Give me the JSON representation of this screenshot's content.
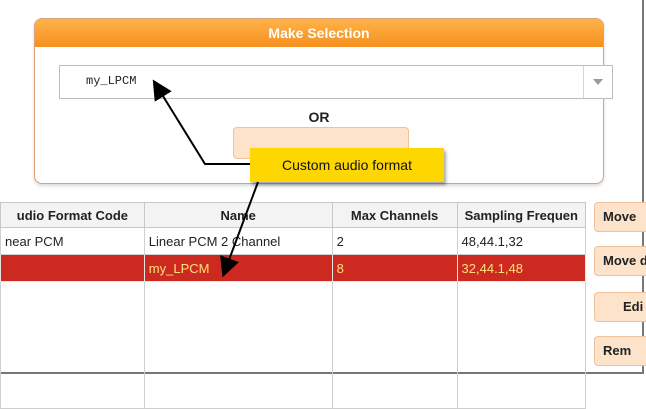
{
  "selection_panel": {
    "title": "Make Selection",
    "dropdown_value": "my_LPCM",
    "or_label": "OR"
  },
  "callout": {
    "text": "Custom audio format"
  },
  "table": {
    "columns": [
      "udio Format Code",
      "Name",
      "Max Channels",
      "Sampling Frequen"
    ],
    "rows": [
      {
        "code": "near PCM",
        "name": "Linear PCM 2 Channel",
        "max_channels": "2",
        "sampling": "48,44.1,32",
        "selected": false
      },
      {
        "code": "",
        "name": "my_LPCM",
        "max_channels": "8",
        "sampling": "32,44.1,48",
        "selected": true
      }
    ]
  },
  "side_buttons": [
    "Move",
    "Move d",
    "Edi",
    "Rem"
  ],
  "colors": {
    "header_orange": "#f6911f",
    "selected_row": "#cc2a21",
    "callout": "#ffd700"
  }
}
